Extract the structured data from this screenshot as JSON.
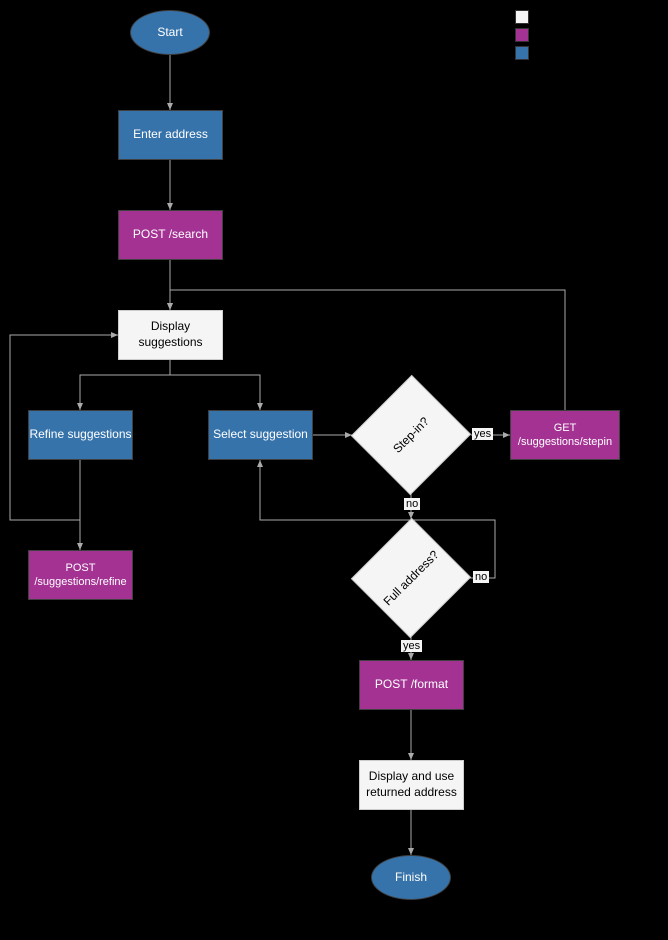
{
  "nodes": {
    "start": "Start",
    "enter_address": "Enter address",
    "post_search": "POST /search",
    "display_suggestions": "Display suggestions",
    "refine_suggestions": "Refine suggestions",
    "select_suggestion": "Select suggestion",
    "step_in": "Step-in?",
    "get_stepin": "GET /suggestions/stepin",
    "full_address": "Full address?",
    "post_refine": "POST /suggestions/refine",
    "post_format": "POST /format",
    "display_returned": "Display and use returned address",
    "finish": "Finish"
  },
  "edges": {
    "yes": "yes",
    "no": "no"
  },
  "legend": {
    "white": "",
    "purple": "",
    "blue": ""
  },
  "chart_data": {
    "type": "flowchart",
    "nodes": [
      {
        "id": "start",
        "label": "Start",
        "shape": "ellipse",
        "color": "blue"
      },
      {
        "id": "enter_address",
        "label": "Enter address",
        "shape": "rect",
        "color": "blue"
      },
      {
        "id": "post_search",
        "label": "POST /search",
        "shape": "rect",
        "color": "purple"
      },
      {
        "id": "display_suggestions",
        "label": "Display suggestions",
        "shape": "rect",
        "color": "white"
      },
      {
        "id": "refine_suggestions",
        "label": "Refine suggestions",
        "shape": "rect",
        "color": "blue"
      },
      {
        "id": "select_suggestion",
        "label": "Select suggestion",
        "shape": "rect",
        "color": "blue"
      },
      {
        "id": "step_in",
        "label": "Step-in?",
        "shape": "diamond",
        "color": "white"
      },
      {
        "id": "get_stepin",
        "label": "GET /suggestions/stepin",
        "shape": "rect",
        "color": "purple"
      },
      {
        "id": "full_address",
        "label": "Full address?",
        "shape": "diamond",
        "color": "white"
      },
      {
        "id": "post_refine",
        "label": "POST /suggestions/refine",
        "shape": "rect",
        "color": "purple"
      },
      {
        "id": "post_format",
        "label": "POST /format",
        "shape": "rect",
        "color": "purple"
      },
      {
        "id": "display_returned",
        "label": "Display and use returned address",
        "shape": "rect",
        "color": "white"
      },
      {
        "id": "finish",
        "label": "Finish",
        "shape": "ellipse",
        "color": "blue"
      }
    ],
    "edges": [
      {
        "from": "start",
        "to": "enter_address"
      },
      {
        "from": "enter_address",
        "to": "post_search"
      },
      {
        "from": "post_search",
        "to": "display_suggestions"
      },
      {
        "from": "display_suggestions",
        "to": "refine_suggestions"
      },
      {
        "from": "display_suggestions",
        "to": "select_suggestion"
      },
      {
        "from": "refine_suggestions",
        "to": "post_refine"
      },
      {
        "from": "post_refine",
        "to": "display_suggestions"
      },
      {
        "from": "select_suggestion",
        "to": "step_in"
      },
      {
        "from": "step_in",
        "to": "get_stepin",
        "label": "yes"
      },
      {
        "from": "get_stepin",
        "to": "display_suggestions"
      },
      {
        "from": "step_in",
        "to": "full_address",
        "label": "no"
      },
      {
        "from": "full_address",
        "to": "select_suggestion",
        "label": "no"
      },
      {
        "from": "full_address",
        "to": "post_format",
        "label": "yes"
      },
      {
        "from": "post_format",
        "to": "display_returned"
      },
      {
        "from": "display_returned",
        "to": "finish"
      }
    ],
    "legend": [
      {
        "color": "white"
      },
      {
        "color": "purple"
      },
      {
        "color": "blue"
      }
    ]
  }
}
